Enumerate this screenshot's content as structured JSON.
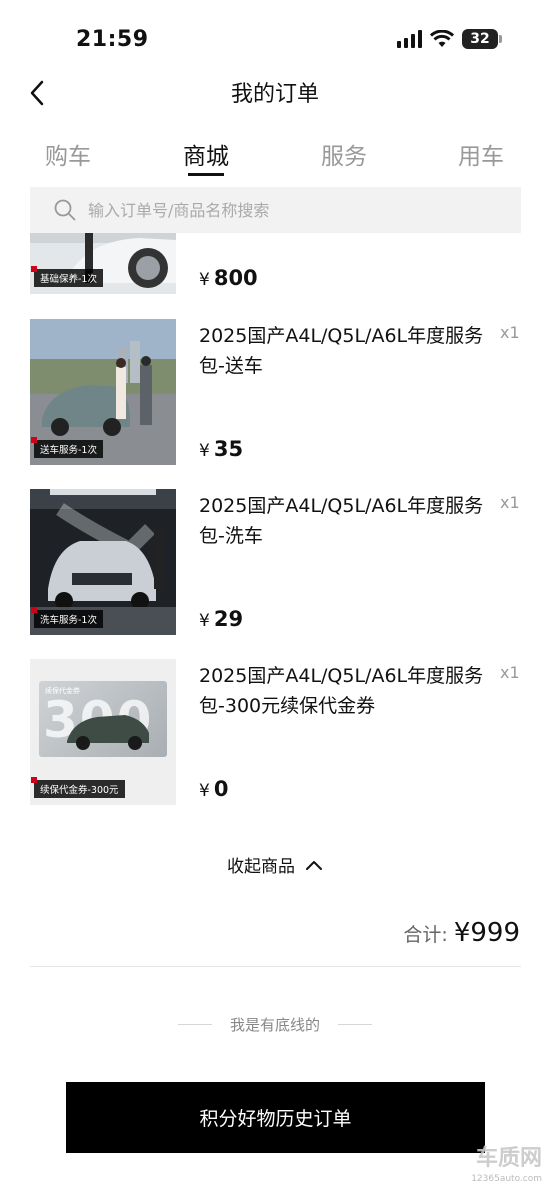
{
  "status": {
    "time": "21:59",
    "battery": "32"
  },
  "nav": {
    "title": "我的订单"
  },
  "tabs": [
    {
      "label": "购车",
      "active": false
    },
    {
      "label": "商城",
      "active": true
    },
    {
      "label": "服务",
      "active": false
    },
    {
      "label": "用车",
      "active": false
    }
  ],
  "search": {
    "placeholder": "输入订单号/商品名称搜索"
  },
  "items": [
    {
      "title": "",
      "qty": "",
      "price": "800",
      "currency": "¥",
      "tag": "基础保养-1次",
      "image": "car-service-photo"
    },
    {
      "title": "2025国产A4L/Q5L/A6L年度服务包-送车",
      "qty": "x1",
      "price": "35",
      "currency": "¥",
      "tag": "送车服务-1次",
      "image": "car-delivery-photo"
    },
    {
      "title": "2025国产A4L/Q5L/A6L年度服务包-洗车",
      "qty": "x1",
      "price": "29",
      "currency": "¥",
      "tag": "洗车服务-1次",
      "image": "car-wash-photo"
    },
    {
      "title": "2025国产A4L/Q5L/A6L年度服务包-300元续保代金券",
      "qty": "x1",
      "price": "0",
      "currency": "¥",
      "tag": "续保代金券-300元",
      "image": "voucher-card",
      "voucher_label": "续保代金券",
      "voucher_value": "300"
    }
  ],
  "collapse": {
    "label": "收起商品"
  },
  "total": {
    "label": "合计:",
    "currency": "¥",
    "value": "999"
  },
  "footer": {
    "bottom_text": "我是有底线的",
    "history_button": "积分好物历史订单"
  },
  "watermark": {
    "text": "www.12365auto.com",
    "logo": "车质网",
    "logo_sub": "12365auto.com"
  }
}
